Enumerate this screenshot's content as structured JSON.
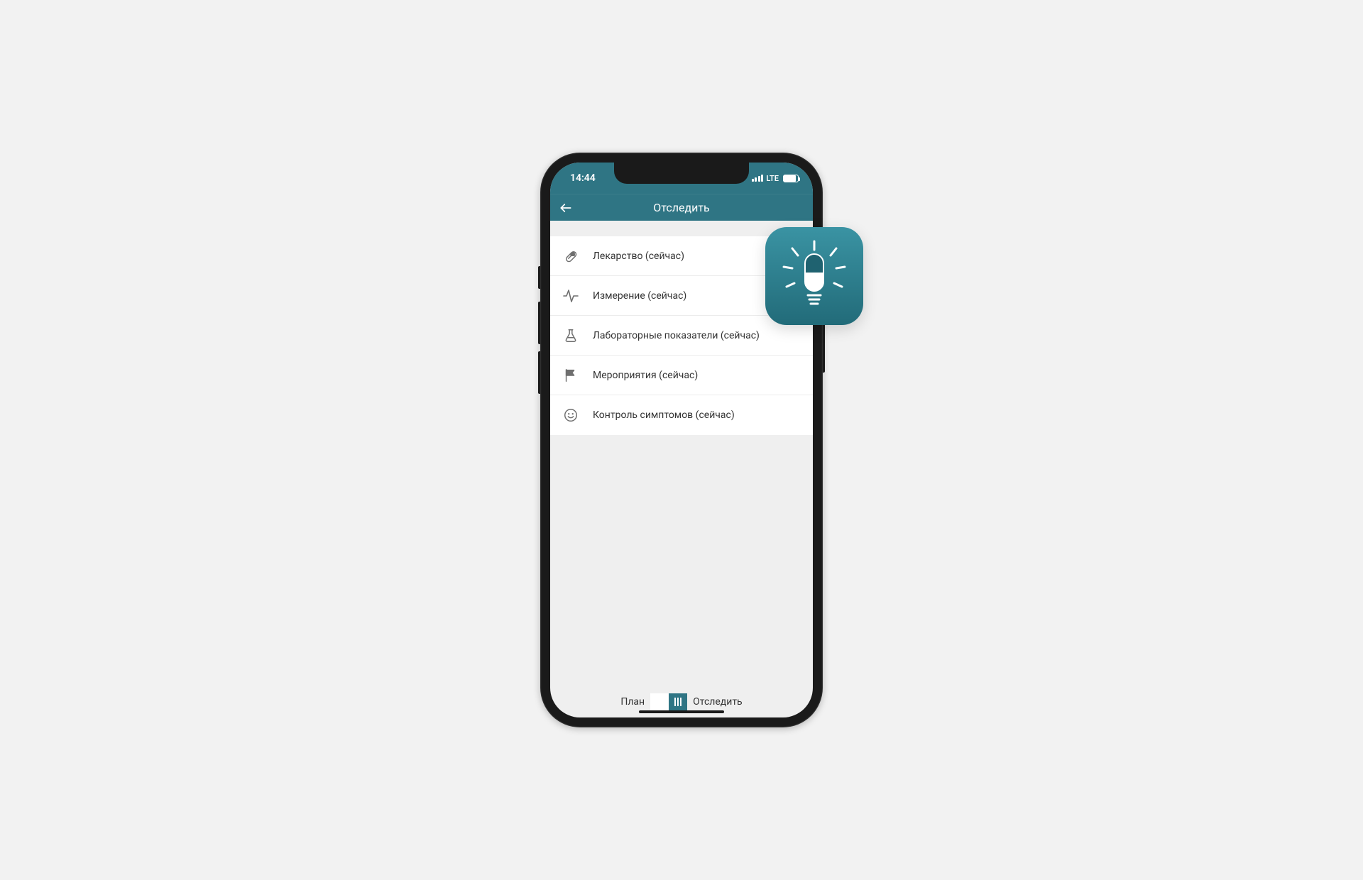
{
  "statusbar": {
    "time": "14:44",
    "network": "LTE"
  },
  "navbar": {
    "title": "Отследить"
  },
  "list": {
    "items": [
      {
        "label": "Лекарство (сейчас)",
        "icon": "pill-icon"
      },
      {
        "label": "Измерение (сейчас)",
        "icon": "pulse-icon"
      },
      {
        "label": "Лабораторные показатели (сейчас)",
        "icon": "flask-icon"
      },
      {
        "label": "Мероприятия (сейчас)",
        "icon": "flag-icon"
      },
      {
        "label": "Контроль симптомов (сейчас)",
        "icon": "smile-icon"
      }
    ]
  },
  "bottom": {
    "left_label": "План",
    "right_label": "Отследить"
  },
  "colors": {
    "accent": "#2f7584"
  }
}
